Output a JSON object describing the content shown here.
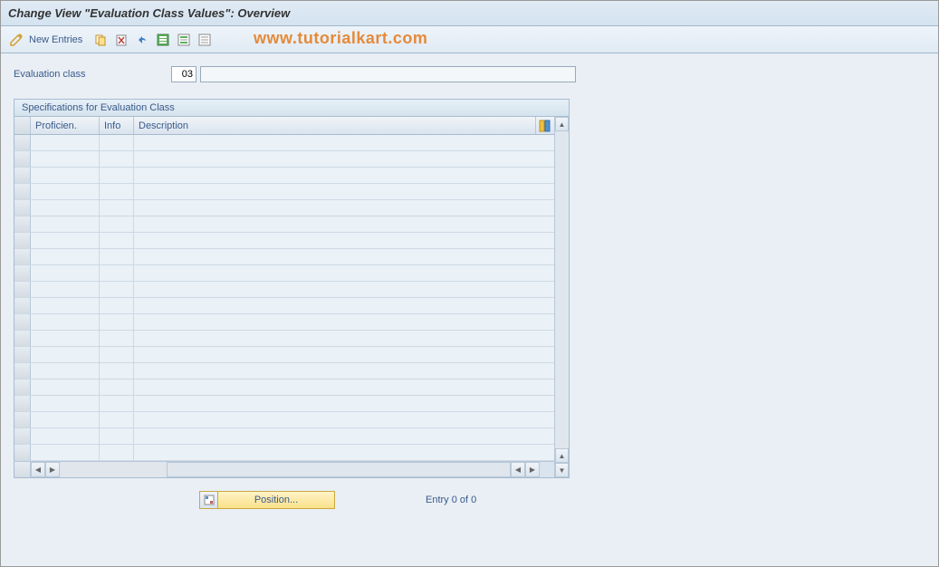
{
  "window": {
    "title": "Change View \"Evaluation Class Values\": Overview"
  },
  "toolbar": {
    "new_entries_label": "New Entries",
    "icons": {
      "change": "change-icon",
      "copy": "copy-icon",
      "delete": "delete-icon",
      "undo": "undo-icon",
      "select_all": "select-all-icon",
      "select_block": "select-block-icon",
      "deselect": "deselect-icon"
    }
  },
  "watermark": "www.tutorialkart.com",
  "form": {
    "eval_class_label": "Evaluation class",
    "eval_class_value": "03",
    "eval_class_desc": ""
  },
  "panel": {
    "title": "Specifications for Evaluation Class",
    "columns": {
      "proficiency": "Proficien.",
      "info": "Info",
      "description": "Description"
    },
    "rows": []
  },
  "footer": {
    "position_button_label": "Position...",
    "entry_status": "Entry 0 of 0"
  }
}
